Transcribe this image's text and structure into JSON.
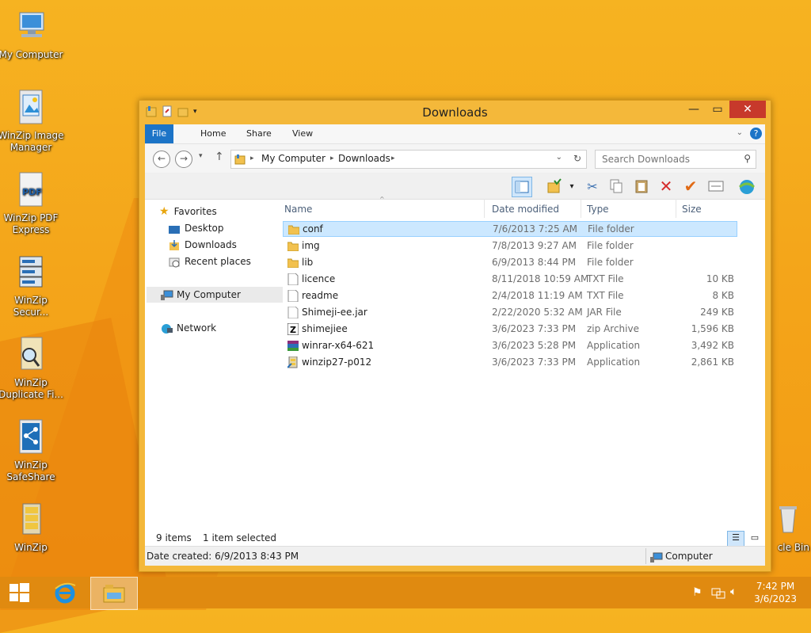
{
  "desktop": {
    "icons": [
      {
        "label": "My Computer",
        "icon": "my-computer-icon"
      },
      {
        "label": "WinZip Image Manager",
        "icon": "winzip-image-manager-icon"
      },
      {
        "label": "WinZip PDF Express",
        "icon": "winzip-pdf-express-icon"
      },
      {
        "label": "WinZip Secur...",
        "icon": "winzip-secure-icon"
      },
      {
        "label": "WinZip Duplicate Fi...",
        "icon": "winzip-duplicate-finder-icon"
      },
      {
        "label": "WinZip SafeShare",
        "icon": "winzip-safeshare-icon"
      },
      {
        "label": "WinZip",
        "icon": "winzip-icon"
      }
    ],
    "recycle_partial": "cle Bin"
  },
  "window": {
    "title": "Downloads",
    "ribbon_tabs": [
      "File",
      "Home",
      "Share",
      "View"
    ],
    "address": {
      "segments": [
        "My Computer",
        "Downloads"
      ]
    },
    "search_placeholder": "Search Downloads",
    "nav": {
      "favorites": "Favorites",
      "desktop": "Desktop",
      "downloads": "Downloads",
      "recent": "Recent places",
      "computer": "My Computer",
      "network": "Network"
    },
    "columns": {
      "name": "Name",
      "date": "Date modified",
      "type": "Type",
      "size": "Size"
    },
    "files": [
      {
        "name": "conf",
        "date": "7/6/2013 7:25 AM",
        "type": "File folder",
        "size": "",
        "icon": "folder-icon",
        "selected": true
      },
      {
        "name": "img",
        "date": "7/8/2013 9:27 AM",
        "type": "File folder",
        "size": "",
        "icon": "folder-icon"
      },
      {
        "name": "lib",
        "date": "6/9/2013 8:44 PM",
        "type": "File folder",
        "size": "",
        "icon": "folder-icon"
      },
      {
        "name": "licence",
        "date": "8/11/2018 10:59 AM",
        "type": "TXT File",
        "size": "10 KB",
        "icon": "text-file-icon"
      },
      {
        "name": "readme",
        "date": "2/4/2018 11:19 AM",
        "type": "TXT File",
        "size": "8 KB",
        "icon": "text-file-icon"
      },
      {
        "name": "Shimeji-ee.jar",
        "date": "2/22/2020 5:32 AM",
        "type": "JAR File",
        "size": "249 KB",
        "icon": "jar-file-icon"
      },
      {
        "name": "shimejiee",
        "date": "3/6/2023 7:33 PM",
        "type": "zip Archive",
        "size": "1,596 KB",
        "icon": "zip-archive-icon"
      },
      {
        "name": "winrar-x64-621",
        "date": "3/6/2023 5:28 PM",
        "type": "Application",
        "size": "3,492 KB",
        "icon": "winrar-icon"
      },
      {
        "name": "winzip27-p012",
        "date": "3/6/2023 7:33 PM",
        "type": "Application",
        "size": "2,861 KB",
        "icon": "winzip-installer-icon"
      }
    ],
    "status": {
      "items": "9 items",
      "selected": "1 item selected"
    },
    "details": {
      "date_created": "Date created: 6/9/2013 8:43 PM",
      "location": "Computer"
    }
  },
  "taskbar": {
    "time": "7:42 PM",
    "date": "3/6/2023"
  }
}
